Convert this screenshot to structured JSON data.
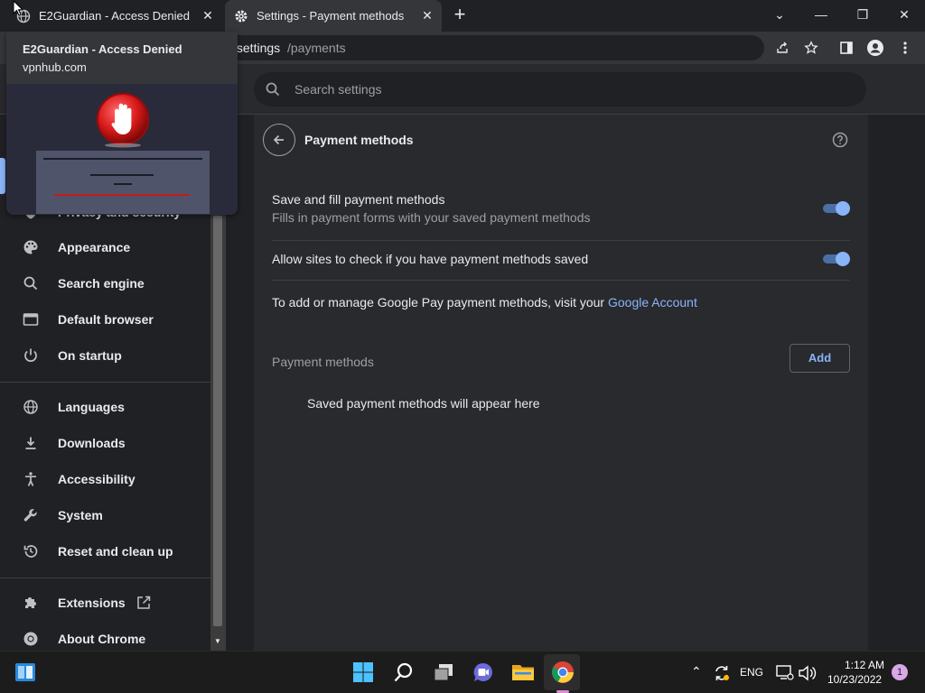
{
  "tabs": [
    {
      "title": "E2Guardian - Access Denied",
      "close": "✕"
    },
    {
      "title": "Settings - Payment methods",
      "close": "✕"
    }
  ],
  "newtab_label": "+",
  "window_controls": {
    "minimize": "—",
    "restore": "❐",
    "close": "✕",
    "tab_search": "⌄"
  },
  "omnibox": {
    "path_prefix": "/settings",
    "path_rest": "/payments"
  },
  "hover_card": {
    "title": "E2Guardian - Access Denied",
    "url": "vpnhub.com"
  },
  "search": {
    "placeholder": "Search settings"
  },
  "sidebar": {
    "items": [
      {
        "label": "Privacy and security",
        "icon": "shield-icon"
      },
      {
        "label": "Appearance",
        "icon": "palette-icon"
      },
      {
        "label": "Search engine",
        "icon": "search-icon"
      },
      {
        "label": "Default browser",
        "icon": "browser-icon"
      },
      {
        "label": "On startup",
        "icon": "power-icon"
      },
      {
        "label": "Languages",
        "icon": "globe-icon"
      },
      {
        "label": "Downloads",
        "icon": "download-icon"
      },
      {
        "label": "Accessibility",
        "icon": "accessibility-icon"
      },
      {
        "label": "System",
        "icon": "wrench-icon"
      },
      {
        "label": "Reset and clean up",
        "icon": "history-icon"
      },
      {
        "label": "Extensions",
        "icon": "puzzle-icon"
      },
      {
        "label": "About Chrome",
        "icon": "chrome-icon"
      }
    ]
  },
  "page": {
    "title": "Payment methods",
    "save_fill_title": "Save and fill payment methods",
    "save_fill_sub": "Fills in payment forms with your saved payment methods",
    "save_fill_on": true,
    "allow_sites_title": "Allow sites to check if you have payment methods saved",
    "allow_sites_on": true,
    "gpay_text": "To add or manage Google Pay payment methods, visit your",
    "gpay_link": "Google Account",
    "section_label": "Payment methods",
    "add_label": "Add",
    "empty_text": "Saved payment methods will appear here"
  },
  "taskbar": {
    "lang": "ENG",
    "time": "1:12 AM",
    "date": "10/23/2022",
    "notifications": "1"
  },
  "colors": {
    "accent": "#8ab4f8",
    "toggle_track": "#4a6fa5",
    "bg": "#202124",
    "card": "#292a2d"
  }
}
